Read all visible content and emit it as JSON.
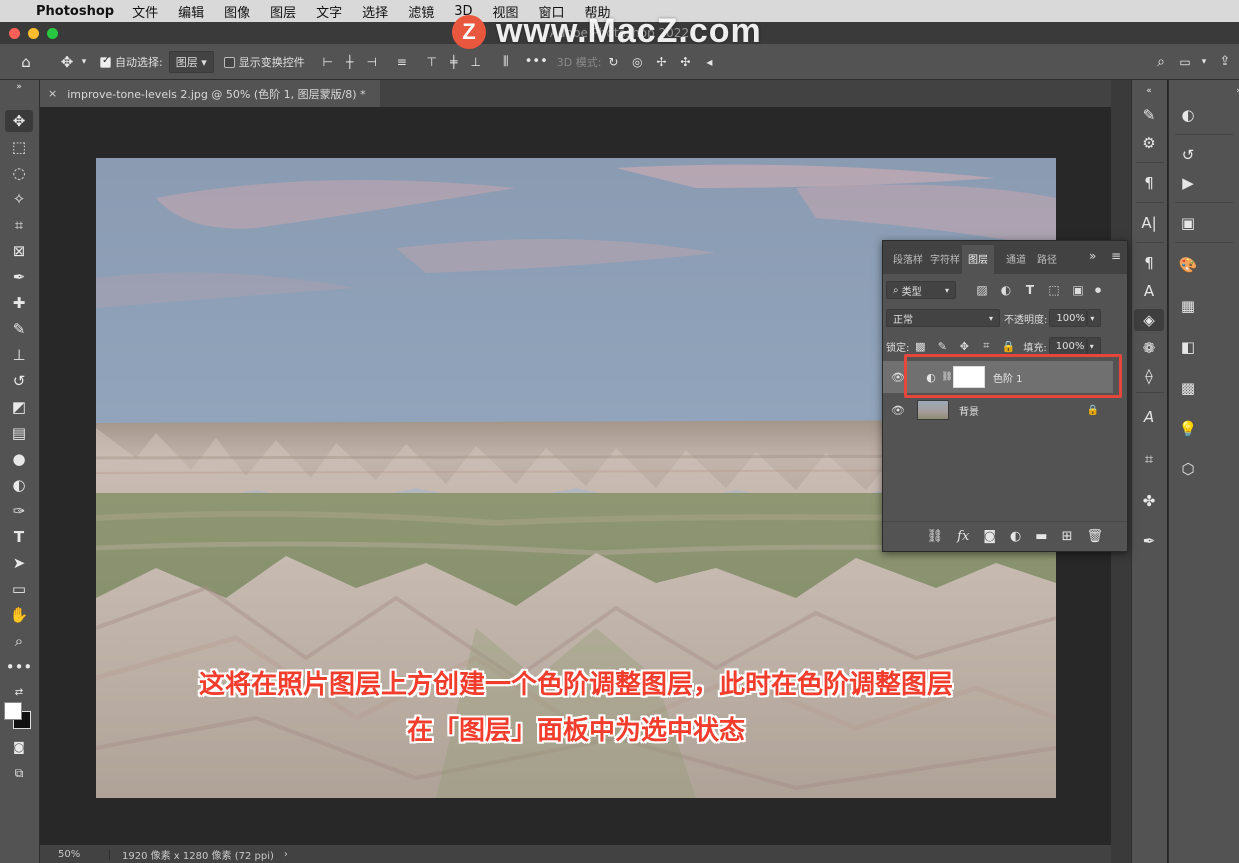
{
  "menubar": {
    "app_name": "Photoshop",
    "items": [
      "文件",
      "编辑",
      "图像",
      "图层",
      "文字",
      "选择",
      "滤镜",
      "3D",
      "视图",
      "窗口",
      "帮助"
    ]
  },
  "window": {
    "title": "Adobe Photoshop 2022"
  },
  "watermark": {
    "logo": "Z",
    "text": "www.MacZ.com"
  },
  "options_bar": {
    "auto_select_label": "自动选择:",
    "auto_select_value": "图层",
    "show_transform_label": "显示变换控件",
    "mode_3d_label": "3D 模式:"
  },
  "document": {
    "tab_title": "improve-tone-levels 2.jpg @ 50% (色阶 1, 图层蒙版/8) *",
    "close_symbol": "×"
  },
  "status_bar": {
    "zoom": "50%",
    "info": "1920 像素 x 1280 像素 (72 ppi)"
  },
  "layers_panel": {
    "tabs": [
      "段落样",
      "字符样",
      "图层",
      "通道",
      "路径"
    ],
    "active_tab": "图层",
    "filter_value": "类型",
    "blend_mode": "正常",
    "opacity_label": "不透明度:",
    "opacity_value": "100%",
    "lock_label": "锁定:",
    "fill_label": "填充:",
    "fill_value": "100%",
    "layers": [
      {
        "name": "色阶 1",
        "selected": true
      },
      {
        "name": "背景",
        "selected": false
      }
    ]
  },
  "caption": {
    "line1": "这将在照片图层上方创建一个色阶调整图层，此时在色阶调整图层",
    "line2": "在「图层」面板中为选中状态"
  },
  "colors": {
    "accent_red": "#e6473a",
    "caption_red": "#f23c2c",
    "ui_gray": "#535353"
  }
}
